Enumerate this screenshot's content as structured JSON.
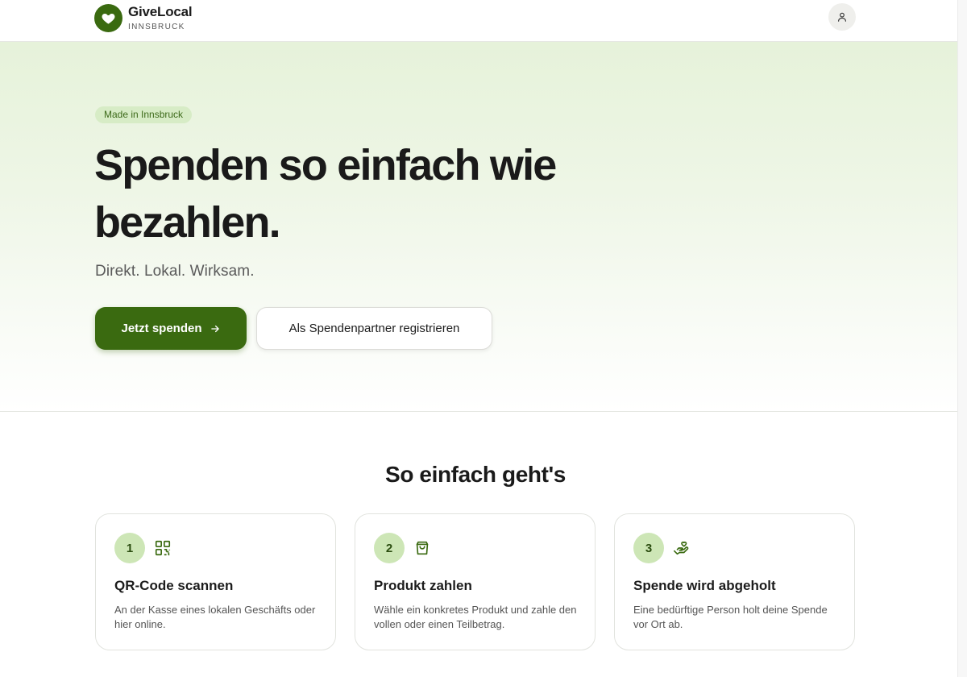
{
  "header": {
    "brand_name": "GiveLocal",
    "brand_subtitle": "INNSBRUCK",
    "brand_icon": "heart-icon",
    "profile_icon": "user-icon"
  },
  "hero": {
    "badge": "Made in Innsbruck",
    "title": "Spenden so einfach wie bezahlen.",
    "subtitle": "Direkt. Lokal. Wirksam.",
    "primary_cta": "Jetzt spenden",
    "primary_cta_icon": "arrow-right-icon",
    "secondary_cta": "Als Spendenpartner registrieren"
  },
  "how_it_works": {
    "title": "So einfach geht's",
    "steps": [
      {
        "number": "1",
        "icon": "qr-code-icon",
        "title": "QR-Code scannen",
        "text": "An der Kasse eines lokalen Geschäfts oder hier online."
      },
      {
        "number": "2",
        "icon": "shopping-bag-icon",
        "title": "Produkt zahlen",
        "text": "Wähle ein konkretes Produkt und zahle den vollen oder einen Teilbetrag."
      },
      {
        "number": "3",
        "icon": "hand-heart-icon",
        "title": "Spende wird abgeholt",
        "text": "Eine bedürftige Person holt deine Spende vor Ort ab."
      }
    ]
  },
  "colors": {
    "brand_green": "#3a6a10",
    "badge_bg": "#d7ecc6",
    "step_circle_bg": "#cde6b6",
    "hero_gradient_top": "#e6f2da"
  }
}
